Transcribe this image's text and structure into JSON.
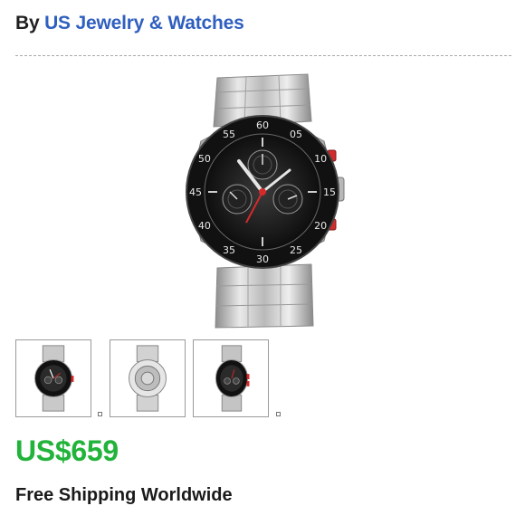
{
  "seller": {
    "prefix": "By",
    "store_name": "US Jewelry & Watches"
  },
  "product": {
    "main_image_icon": "chronograph-watch-image",
    "thumbnails": [
      {
        "icon": "watch-front-thumbnail"
      },
      {
        "icon": "watch-back-thumbnail"
      },
      {
        "icon": "watch-angle-thumbnail"
      }
    ],
    "bezel_numbers": [
      "60",
      "05",
      "10",
      "15",
      "20",
      "25",
      "30",
      "35",
      "40",
      "45",
      "50",
      "55"
    ],
    "price": "US$659",
    "shipping": "Free Shipping Worldwide"
  },
  "colors": {
    "store_link": "#2f5fbf",
    "price": "#22b33a",
    "watch_accent": "#d42a2a"
  }
}
